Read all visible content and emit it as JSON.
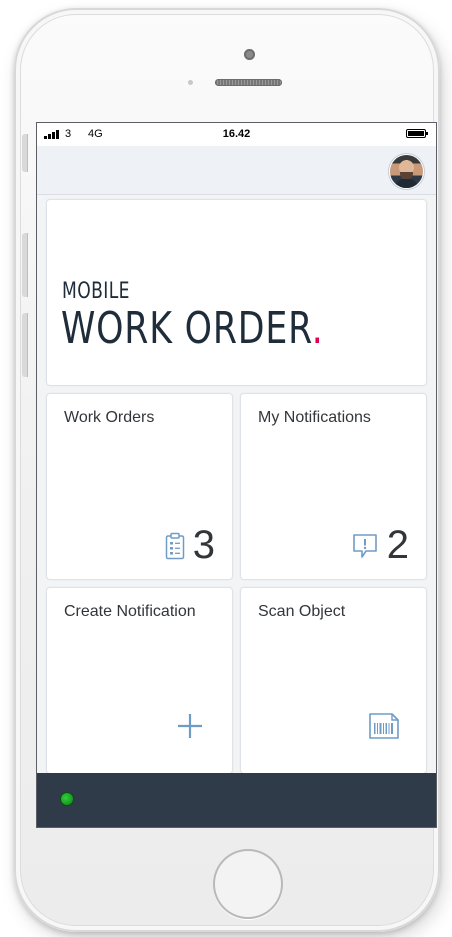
{
  "status_bar": {
    "carrier": "3",
    "network": "4G",
    "time": "16.42"
  },
  "header": {
    "avatar_icon": "user-avatar"
  },
  "banner": {
    "logo_small": "MOBILE",
    "logo_big": "WORK ORDER",
    "logo_dot": ".",
    "accent_color": "#e0004d"
  },
  "tiles": [
    {
      "title": "Work Orders",
      "count": "3",
      "icon": "clipboard-list-icon"
    },
    {
      "title": "My Notifications",
      "count": "2",
      "icon": "alert-message-icon"
    },
    {
      "title": "Create Notification",
      "count": "",
      "icon": "plus-icon"
    },
    {
      "title": "Scan Object",
      "count": "",
      "icon": "barcode-scan-icon"
    }
  ],
  "footer": {
    "status_color": "#22b52c"
  },
  "colors": {
    "icon_blue": "#6f9bc7",
    "footer_bg": "#2f3b48"
  }
}
